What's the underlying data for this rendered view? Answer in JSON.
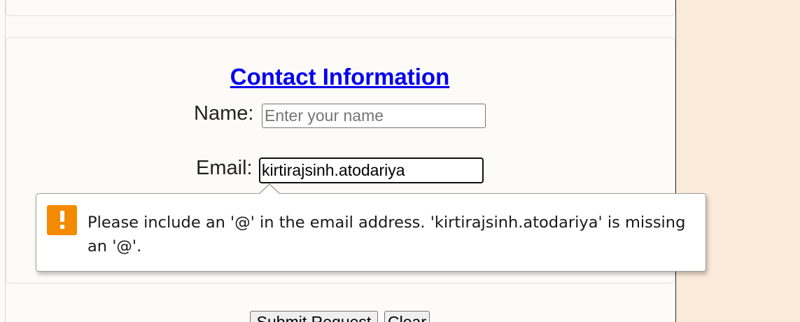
{
  "contact": {
    "heading": "Contact Information",
    "name_label": "Name:",
    "name_placeholder": "Enter your name",
    "name_value": "",
    "email_label": "Email:",
    "email_value": "kirtirajsinh.atodariya"
  },
  "validation_tooltip": {
    "icon": "warning-icon",
    "icon_color": "#f48a00",
    "message": "Please include an '@' in the email address. 'kirtirajsinh.atodariya' is missing an '@'."
  },
  "actions": {
    "submit_label": "Submit Request",
    "clear_label": "Clear"
  },
  "colors": {
    "page_background": "#faeada",
    "content_background": "#fdfbf8",
    "heading_link": "#0000ee"
  }
}
